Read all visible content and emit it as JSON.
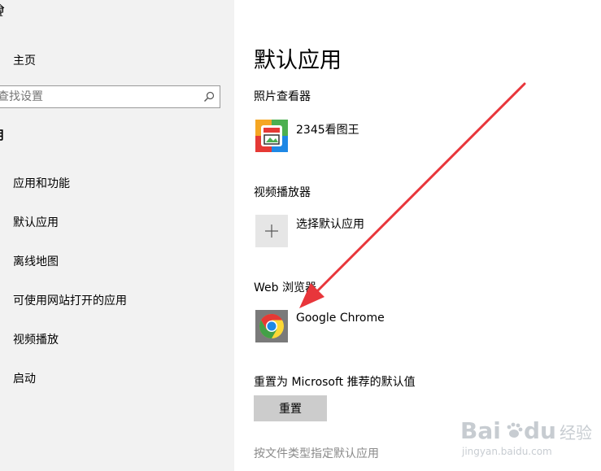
{
  "window": {
    "title": "置"
  },
  "sidebar": {
    "home_label": "主页",
    "search_placeholder": "查找设置",
    "section_title": "用",
    "items": [
      {
        "label": "应用和功能"
      },
      {
        "label": "默认应用"
      },
      {
        "label": "离线地图"
      },
      {
        "label": "可使用网站打开的应用"
      },
      {
        "label": "视频播放"
      },
      {
        "label": "启动"
      }
    ]
  },
  "main": {
    "title": "默认应用",
    "photo_viewer": {
      "label": "照片查看器",
      "app_name": "2345看图王"
    },
    "video_player": {
      "label": "视频播放器",
      "app_name": "选择默认应用"
    },
    "web_browser": {
      "label": "Web 浏览器",
      "app_name": "Google Chrome"
    },
    "reset": {
      "label": "重置为 Microsoft 推荐的默认值",
      "button": "重置"
    },
    "file_type_link": "按文件类型指定默认应用"
  },
  "watermark": {
    "brand_a": "Bai",
    "brand_b": "du",
    "product": "经验",
    "url": "jingyan.baidu.com"
  },
  "colors": {
    "sidebar_bg": "#f2f2f2",
    "button_bg": "#cccccc",
    "arrow": "#e8363b",
    "link": "#8a8a8a"
  }
}
